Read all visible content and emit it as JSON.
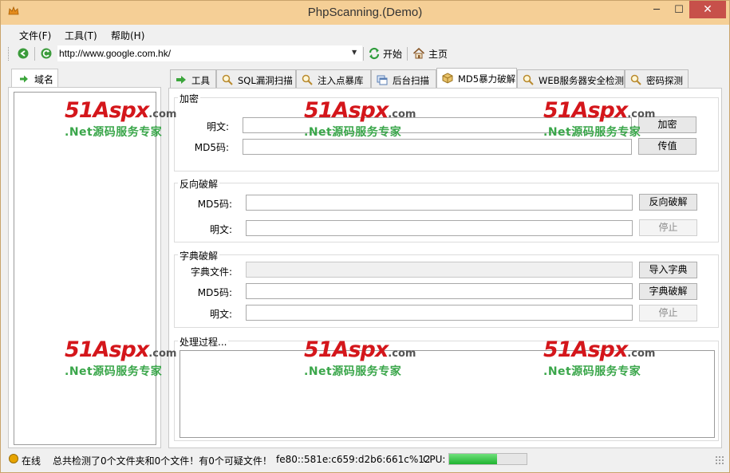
{
  "window": {
    "title": "PhpScanning.(Demo)",
    "min": "─",
    "max": "☐",
    "close": "✕"
  },
  "menu": [
    "文件(F)",
    "工具(T)",
    "帮助(H)"
  ],
  "toolbar": {
    "url": "http://www.google.com.hk/",
    "start_label": "开始",
    "home_label": "主页"
  },
  "left_panel": {
    "tab_label": "域名"
  },
  "tabs": [
    {
      "label": "工具",
      "icon": "arrow-right-icon"
    },
    {
      "label": "SQL漏洞扫描",
      "icon": "magnifier-icon"
    },
    {
      "label": "注入点暴库",
      "icon": "magnifier-icon"
    },
    {
      "label": "后台扫描",
      "icon": "window-icon"
    },
    {
      "label": "MD5暴力破解",
      "icon": "box-icon",
      "active": true
    },
    {
      "label": "WEB服务器安全检测",
      "icon": "magnifier-icon"
    },
    {
      "label": "密码探测",
      "icon": "magnifier-icon"
    }
  ],
  "encrypt": {
    "title": "加密",
    "plain_label": "明文:",
    "plain_value": "",
    "md5_label": "MD5码:",
    "md5_value": "",
    "encrypt_btn": "加密",
    "transfer_btn": "传值"
  },
  "reverse": {
    "title": "反向破解",
    "md5_label": "MD5码:",
    "md5_value": "",
    "plain_label": "明文:",
    "plain_value": "",
    "crack_btn": "反向破解",
    "stop_btn": "停止"
  },
  "dictionary": {
    "title": "字典破解",
    "file_label": "字典文件:",
    "file_value": "",
    "md5_label": "MD5码:",
    "md5_value": "",
    "plain_label": "明文:",
    "plain_value": "",
    "import_btn": "导入字典",
    "crack_btn": "字典破解",
    "stop_btn": "停止"
  },
  "process": {
    "title": "处理过程..."
  },
  "watermark": {
    "brand": "51Aspx",
    "domain": ".com",
    "slogan": ".Net源码服务专家"
  },
  "status": {
    "online": "在线",
    "summary": "总共检测了0个文件夹和0个文件！有0个可疑文件！",
    "address": "fe80::581e:c659:d2b6:661c%12",
    "cpu_label": "CPU:",
    "cpu_level": 0.62
  },
  "colors": {
    "titlebar": "#f5cf96",
    "close": "#c7504a",
    "watermark_red": "#d4161b",
    "watermark_green": "#3aa64a",
    "cpu_fill": "#1fb32f"
  }
}
